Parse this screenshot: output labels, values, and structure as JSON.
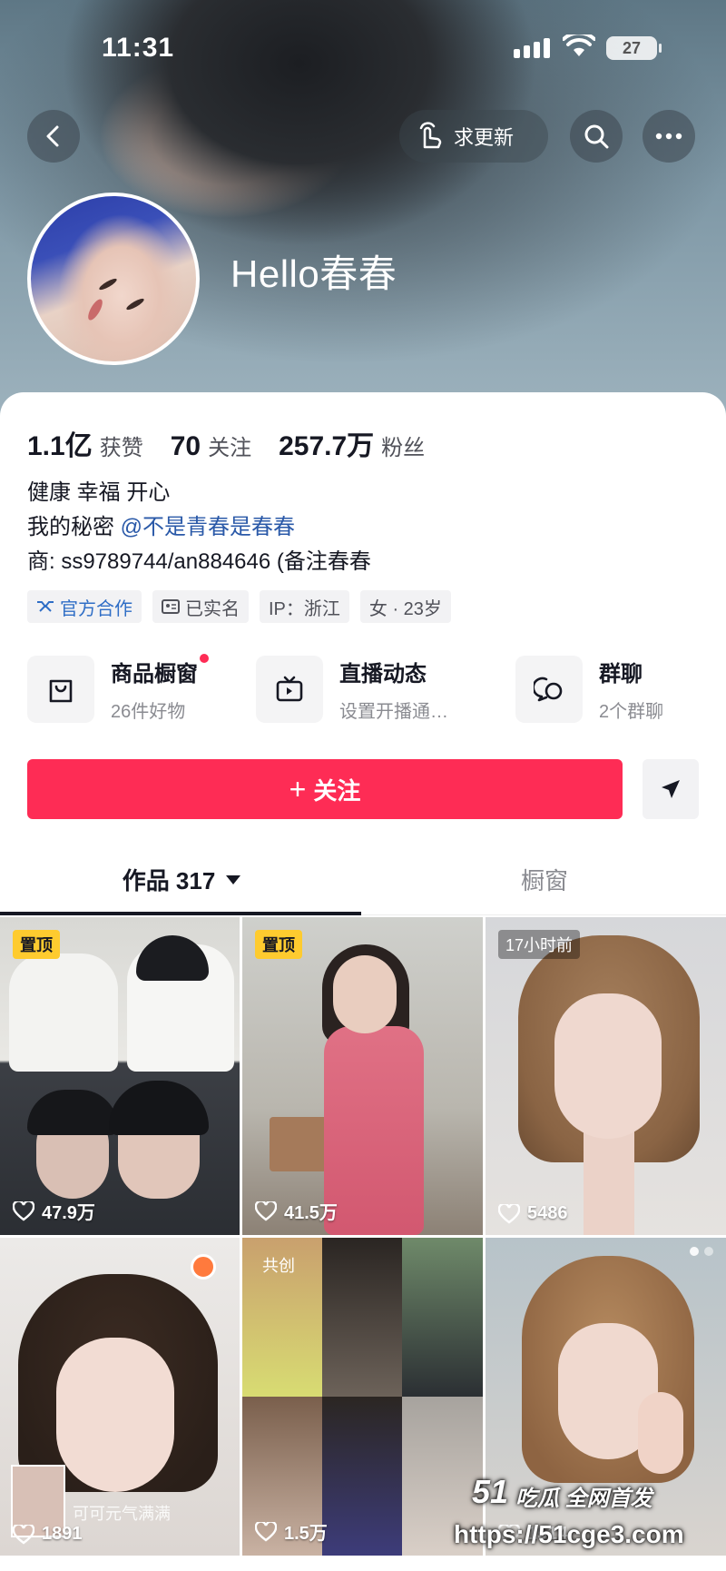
{
  "status_bar": {
    "time": "11:31",
    "battery": "27"
  },
  "header": {
    "update_label": "求更新"
  },
  "profile": {
    "nickname": "Hello春春",
    "stats": [
      {
        "value": "1.1亿",
        "label": "获赞"
      },
      {
        "value": "70",
        "label": "关注"
      },
      {
        "value": "257.7万",
        "label": "粉丝"
      }
    ],
    "bio": {
      "line1": "健康 幸福 开心",
      "line2_prefix": "我的秘密",
      "line2_mention": "@不是青春是春春",
      "line3": "商: ss9789744/an884646 (备注春春"
    },
    "tags": [
      "官方合作",
      "已实名",
      "IP：浙江",
      "女 · 23岁"
    ]
  },
  "entries": [
    {
      "title": "商品橱窗",
      "subtitle": "26件好物",
      "has_dot": true
    },
    {
      "title": "直播动态",
      "subtitle": "设置开播通…"
    },
    {
      "title": "群聊",
      "subtitle": "2个群聊"
    }
  ],
  "actions": {
    "follow_label": "关注",
    "follow_prefix": "+"
  },
  "tabs": {
    "works_label": "作品 317",
    "other_label": "橱窗"
  },
  "posts": [
    {
      "badge": "置顶",
      "likes": "47.9万"
    },
    {
      "badge": "置顶",
      "likes": "41.5万"
    },
    {
      "badge": "17小时前",
      "likes": "5486"
    },
    {
      "likes": "1891",
      "caption": "可可元气满满"
    },
    {
      "badge": "共创",
      "likes": "1.5万"
    },
    {
      "likes": "1514"
    }
  ],
  "watermark": {
    "brand": "51",
    "text": "吃瓜 全网首发",
    "url": "https://51cge3.com"
  },
  "colors": {
    "accent": "#fe2c55",
    "mention": "#2a59a8",
    "pin_badge": "#fecb2f"
  }
}
